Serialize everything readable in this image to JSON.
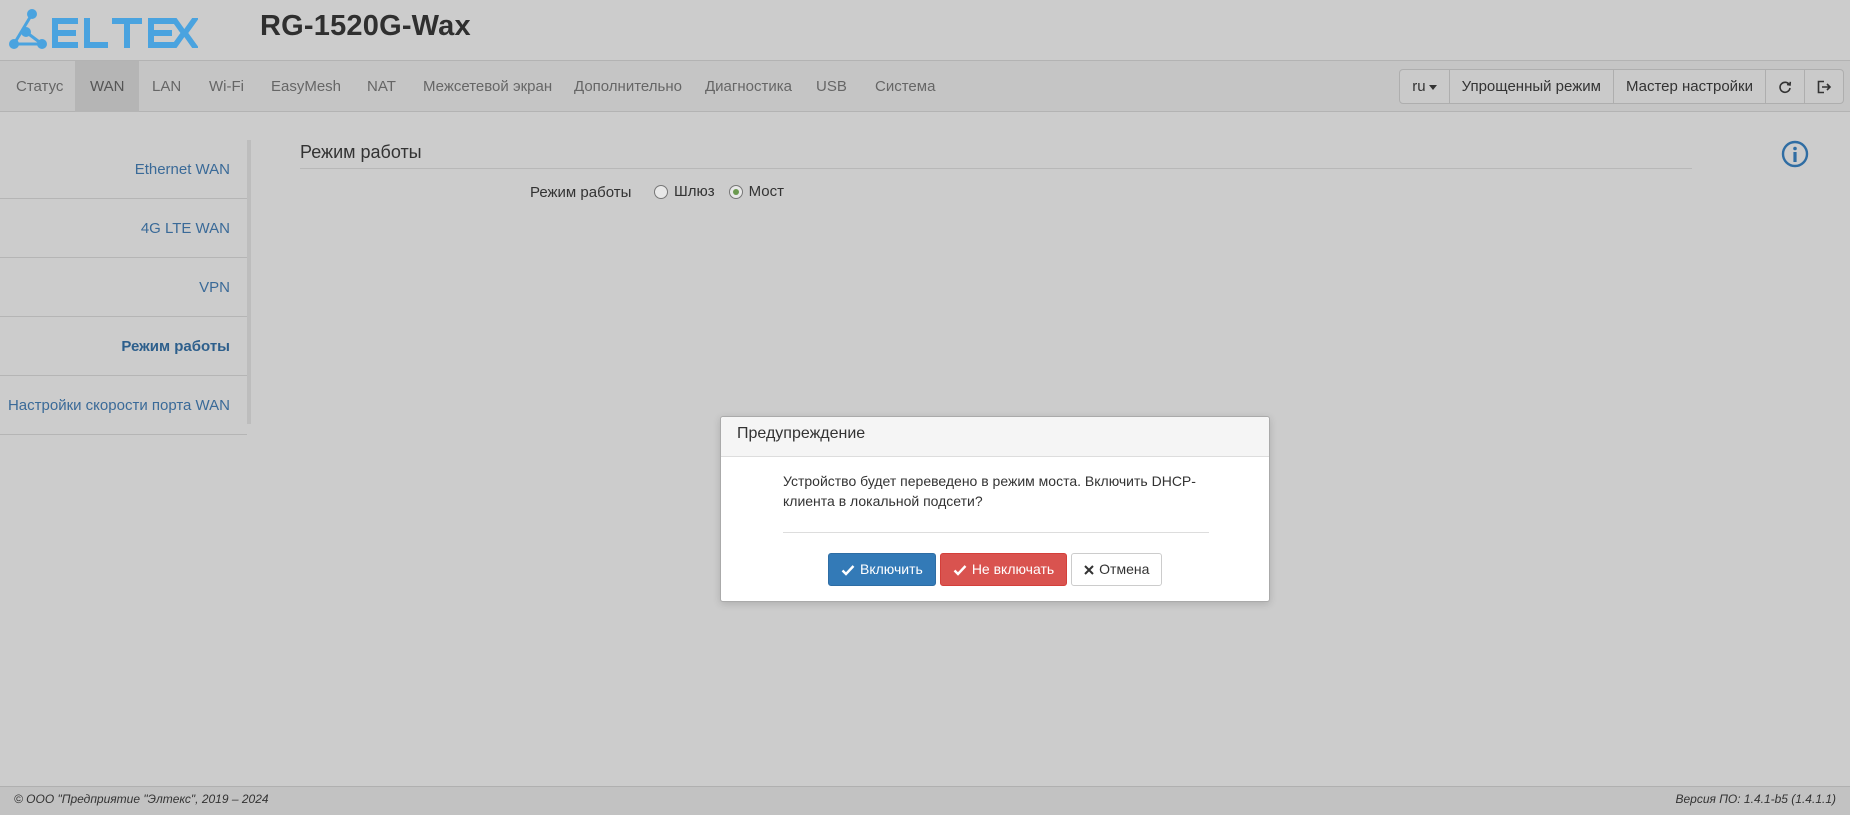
{
  "header": {
    "logo_text": "ELTEX",
    "model": "RG-1520G-Wax"
  },
  "nav": {
    "items": [
      {
        "label": "Статус"
      },
      {
        "label": "WAN"
      },
      {
        "label": "LAN"
      },
      {
        "label": "Wi-Fi"
      },
      {
        "label": "EasyMesh"
      },
      {
        "label": "NAT"
      },
      {
        "label": "Межсетевой экран"
      },
      {
        "label": "Дополнительно"
      },
      {
        "label": "Диагностика"
      },
      {
        "label": "USB"
      },
      {
        "label": "Система"
      }
    ],
    "active": "WAN",
    "lang": "ru",
    "simple_mode": "Упрощенный режим",
    "wizard": "Мастер настройки",
    "refresh_icon": "refresh-icon",
    "logout_icon": "logout-icon"
  },
  "sidebar": {
    "items": [
      {
        "label": "Ethernet WAN"
      },
      {
        "label": "4G LTE WAN"
      },
      {
        "label": "VPN"
      },
      {
        "label": "Режим работы"
      },
      {
        "label": "Настройки скорости порта WAN"
      }
    ],
    "active": "Режим работы"
  },
  "main": {
    "section_title": "Режим работы",
    "field_label": "Режим работы",
    "options": [
      {
        "label": "Шлюз",
        "checked": false
      },
      {
        "label": "Мост",
        "checked": true
      }
    ]
  },
  "modal": {
    "title": "Предупреждение",
    "text": "Устройство будет переведено в режим моста. Включить DHCP-клиента в локальной подсети?",
    "btn_enable": "Включить",
    "btn_disable": "Не включать",
    "btn_cancel": "Отмена"
  },
  "footer": {
    "copyright": "© ООО \"Предприятие \"Элтекс\", 2019 – 2024",
    "version": "Версия ПО: 1.4.1-b5 (1.4.1.1)"
  },
  "colors": {
    "primary": "#337ab7",
    "danger": "#d9534f",
    "logo": "#4aa3df",
    "link": "#3a6a98"
  }
}
